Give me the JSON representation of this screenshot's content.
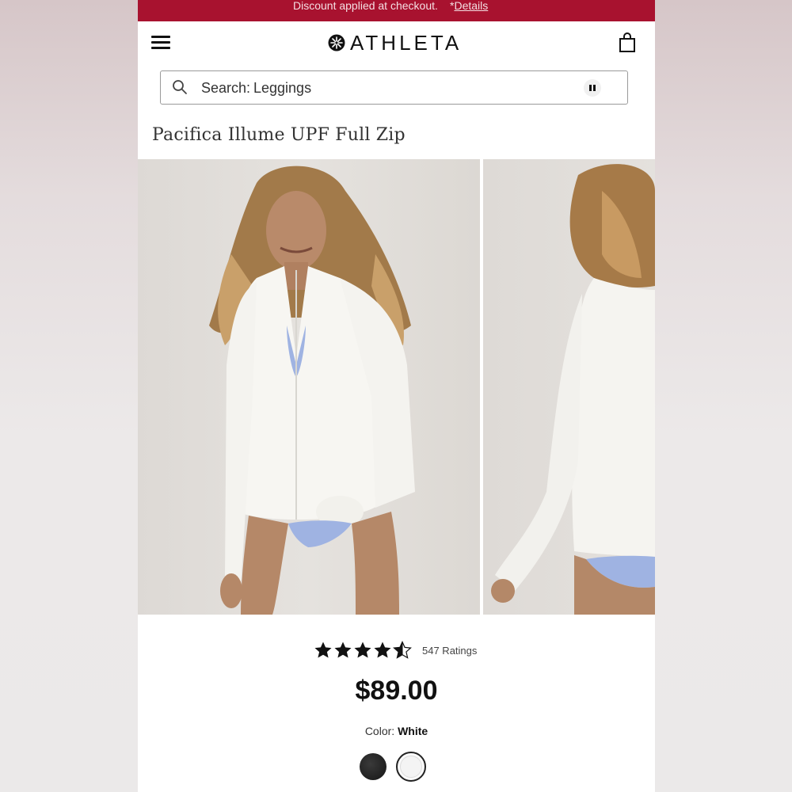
{
  "promo": {
    "text": "Discount applied at checkout.",
    "link_prefix": "*",
    "link_label": "Details"
  },
  "header": {
    "brand": "ATHLETA",
    "menu_icon": "hamburger-menu-icon",
    "bag_icon": "shopping-bag-icon"
  },
  "search": {
    "label": "Search:",
    "value": "Leggings",
    "icon": "search-icon",
    "pause_icon": "pause-icon"
  },
  "product": {
    "title": "Pacifica Illume UPF Full Zip",
    "rating": 4.5,
    "ratings_count": "547 Ratings",
    "price": "$89.00",
    "color_label": "Color:",
    "color_value": "White",
    "swatches": [
      "#1a1a1a",
      "#f6f6f6"
    ]
  },
  "colors": {
    "promo_bg": "#a8122f",
    "text": "#111111"
  }
}
